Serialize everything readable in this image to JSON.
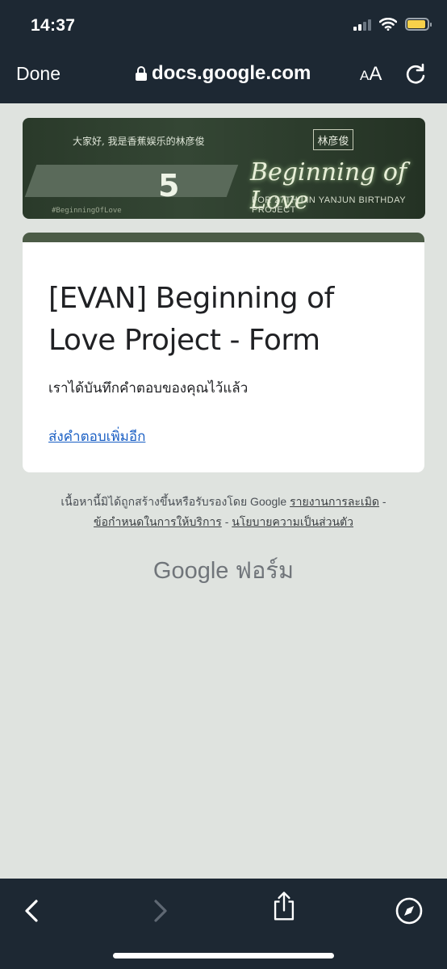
{
  "status": {
    "time": "14:37"
  },
  "browser": {
    "done_label": "Done",
    "url": "docs.google.com",
    "aa_small": "A",
    "aa_large": "A"
  },
  "banner": {
    "chinese_text": "大家好, 我是香蕉娱乐的林彦俊",
    "logo": "林彦俊",
    "number": "5",
    "title": "Beginning of Love",
    "subtitle": "FOR 27TH LIN YANJUN BIRTHDAY PROJECT",
    "hashtag": "#BeginningOfLove"
  },
  "card": {
    "title": "[EVAN] Beginning of Love Project - Form",
    "confirmation": "เราได้บันทึกคำตอบของคุณไว้แล้ว",
    "another_response_link": "ส่งคำตอบเพิ่มอีก"
  },
  "footer": {
    "disclaimer": "เนื้อหานี้มิได้ถูกสร้างขึ้นหรือรับรองโดย Google",
    "report_abuse": "รายงานการละเมิด",
    "sep1": " - ",
    "terms": "ข้อกำหนดในการให้บริการ",
    "sep2": " - ",
    "privacy": "นโยบายความเป็นส่วนตัว",
    "google_forms": "Google ฟอร์ม"
  },
  "colors": {
    "bar_bg": "#1d2833",
    "page_bg": "#dfe3df",
    "accent": "#4b5b46",
    "link": "#1a5fc4"
  },
  "icons": [
    "signal-icon",
    "wifi-icon",
    "battery-icon",
    "lock-icon",
    "reload-icon",
    "back-arrow-icon",
    "forward-arrow-icon",
    "share-icon",
    "compass-icon"
  ]
}
